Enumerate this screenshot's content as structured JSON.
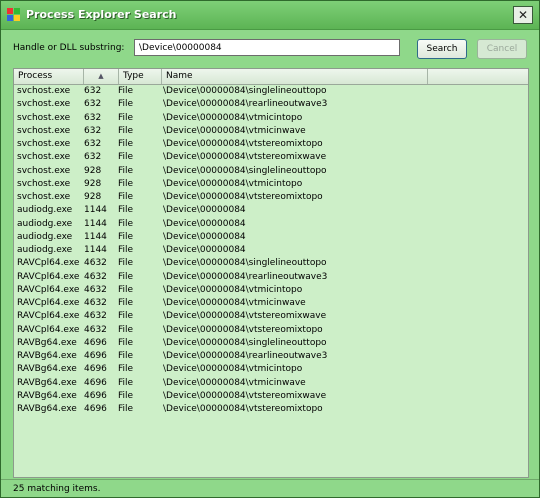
{
  "window": {
    "title": "Process Explorer Search"
  },
  "search": {
    "label": "Handle or DLL substring:",
    "value": "\\Device\\00000084",
    "search_button": "Search",
    "cancel_button": "Cancel"
  },
  "list": {
    "columns": {
      "process": "Process",
      "sort_indicator": "▲",
      "type": "Type",
      "name": "Name"
    },
    "rows": [
      {
        "process": "svchost.exe",
        "pid": "632",
        "type": "File",
        "name": "\\Device\\00000084\\singlelineouttopo"
      },
      {
        "process": "svchost.exe",
        "pid": "632",
        "type": "File",
        "name": "\\Device\\00000084\\rearlineoutwave3"
      },
      {
        "process": "svchost.exe",
        "pid": "632",
        "type": "File",
        "name": "\\Device\\00000084\\vtmicintopo"
      },
      {
        "process": "svchost.exe",
        "pid": "632",
        "type": "File",
        "name": "\\Device\\00000084\\vtmicinwave"
      },
      {
        "process": "svchost.exe",
        "pid": "632",
        "type": "File",
        "name": "\\Device\\00000084\\vtstereomixtopo"
      },
      {
        "process": "svchost.exe",
        "pid": "632",
        "type": "File",
        "name": "\\Device\\00000084\\vtstereomixwave"
      },
      {
        "process": "svchost.exe",
        "pid": "928",
        "type": "File",
        "name": "\\Device\\00000084\\singlelineouttopo"
      },
      {
        "process": "svchost.exe",
        "pid": "928",
        "type": "File",
        "name": "\\Device\\00000084\\vtmicintopo"
      },
      {
        "process": "svchost.exe",
        "pid": "928",
        "type": "File",
        "name": "\\Device\\00000084\\vtstereomixtopo"
      },
      {
        "process": "audiodg.exe",
        "pid": "1144",
        "type": "File",
        "name": "\\Device\\00000084"
      },
      {
        "process": "audiodg.exe",
        "pid": "1144",
        "type": "File",
        "name": "\\Device\\00000084"
      },
      {
        "process": "audiodg.exe",
        "pid": "1144",
        "type": "File",
        "name": "\\Device\\00000084"
      },
      {
        "process": "audiodg.exe",
        "pid": "1144",
        "type": "File",
        "name": "\\Device\\00000084"
      },
      {
        "process": "RAVCpl64.exe",
        "pid": "4632",
        "type": "File",
        "name": "\\Device\\00000084\\singlelineouttopo"
      },
      {
        "process": "RAVCpl64.exe",
        "pid": "4632",
        "type": "File",
        "name": "\\Device\\00000084\\rearlineoutwave3"
      },
      {
        "process": "RAVCpl64.exe",
        "pid": "4632",
        "type": "File",
        "name": "\\Device\\00000084\\vtmicintopo"
      },
      {
        "process": "RAVCpl64.exe",
        "pid": "4632",
        "type": "File",
        "name": "\\Device\\00000084\\vtmicinwave"
      },
      {
        "process": "RAVCpl64.exe",
        "pid": "4632",
        "type": "File",
        "name": "\\Device\\00000084\\vtstereomixwave"
      },
      {
        "process": "RAVCpl64.exe",
        "pid": "4632",
        "type": "File",
        "name": "\\Device\\00000084\\vtstereomixtopo"
      },
      {
        "process": "RAVBg64.exe",
        "pid": "4696",
        "type": "File",
        "name": "\\Device\\00000084\\singlelineouttopo"
      },
      {
        "process": "RAVBg64.exe",
        "pid": "4696",
        "type": "File",
        "name": "\\Device\\00000084\\rearlineoutwave3"
      },
      {
        "process": "RAVBg64.exe",
        "pid": "4696",
        "type": "File",
        "name": "\\Device\\00000084\\vtmicintopo"
      },
      {
        "process": "RAVBg64.exe",
        "pid": "4696",
        "type": "File",
        "name": "\\Device\\00000084\\vtmicinwave"
      },
      {
        "process": "RAVBg64.exe",
        "pid": "4696",
        "type": "File",
        "name": "\\Device\\00000084\\vtstereomixwave"
      },
      {
        "process": "RAVBg64.exe",
        "pid": "4696",
        "type": "File",
        "name": "\\Device\\00000084\\vtstereomixtopo"
      }
    ]
  },
  "status": {
    "text": "25 matching items."
  },
  "icons": {
    "title": "windows-flag-icon",
    "close": "close-icon"
  },
  "colors": {
    "window_bg": "#8fd88a",
    "list_bg": "#cdefc8"
  }
}
